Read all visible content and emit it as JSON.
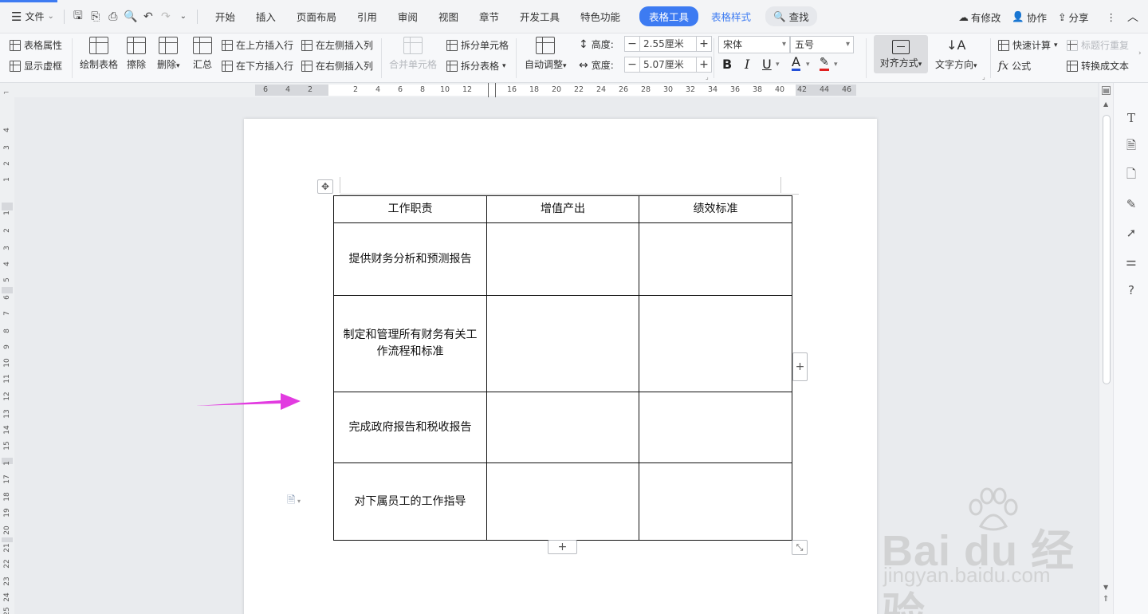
{
  "menubar": {
    "file": "文件",
    "tabs": [
      "开始",
      "插入",
      "页面布局",
      "引用",
      "审阅",
      "视图",
      "章节",
      "开发工具",
      "特色功能"
    ],
    "table_tools": "表格工具",
    "table_style": "表格样式",
    "search": "查找",
    "modified": "有修改",
    "collab": "协作",
    "share": "分享"
  },
  "ribbon": {
    "table_props": "表格属性",
    "show_grid": "显示虚框",
    "draw_table": "绘制表格",
    "erase": "擦除",
    "delete": "删除",
    "summary": "汇总",
    "insert_above": "在上方插入行",
    "insert_below": "在下方插入行",
    "insert_left": "在左侧插入列",
    "insert_right": "在右侧插入列",
    "merge_cells": "合并单元格",
    "split_cells": "拆分单元格",
    "split_table": "拆分表格",
    "auto_adjust": "自动调整",
    "height_label": "高度:",
    "height_value": "2.55厘米",
    "width_label": "宽度:",
    "width_value": "5.07厘米",
    "font_name": "宋体",
    "font_size": "五号",
    "align": "对齐方式",
    "text_direction": "文字方向",
    "quick_calc": "快速计算",
    "repeat_header": "标题行重复",
    "formula": "公式",
    "to_text": "转换成文本"
  },
  "hruler_ticks": [
    "6",
    "4",
    "2",
    "2",
    "4",
    "6",
    "8",
    "10",
    "12",
    "16",
    "18",
    "20",
    "22",
    "24",
    "26",
    "28",
    "30",
    "32",
    "34",
    "36",
    "38",
    "40",
    "42",
    "44",
    "46"
  ],
  "vruler_ticks": [
    "4",
    "3",
    "2",
    "1",
    "1",
    "2",
    "3",
    "4",
    "5",
    "6",
    "7",
    "8",
    "9",
    "10",
    "11",
    "12",
    "13",
    "14",
    "15",
    "1",
    "17",
    "18",
    "19",
    "20",
    "21",
    "22",
    "23",
    "24",
    "25"
  ],
  "table": {
    "header": [
      "工作职责",
      "增值产出",
      "绩效标准"
    ],
    "rows": [
      [
        "提供财务分析和预测报告",
        "",
        ""
      ],
      [
        "制定和管理所有财务有关工作流程和标准",
        "",
        ""
      ],
      [
        "完成政府报告和税收报告",
        "",
        ""
      ],
      [
        "对下属员工的工作指导",
        "",
        ""
      ]
    ]
  },
  "watermark": {
    "logo": "Bai du 经验",
    "url": "jingyan.baidu.com"
  },
  "colors": {
    "accent": "#3d7bf2",
    "arrow": "#e23be0"
  }
}
